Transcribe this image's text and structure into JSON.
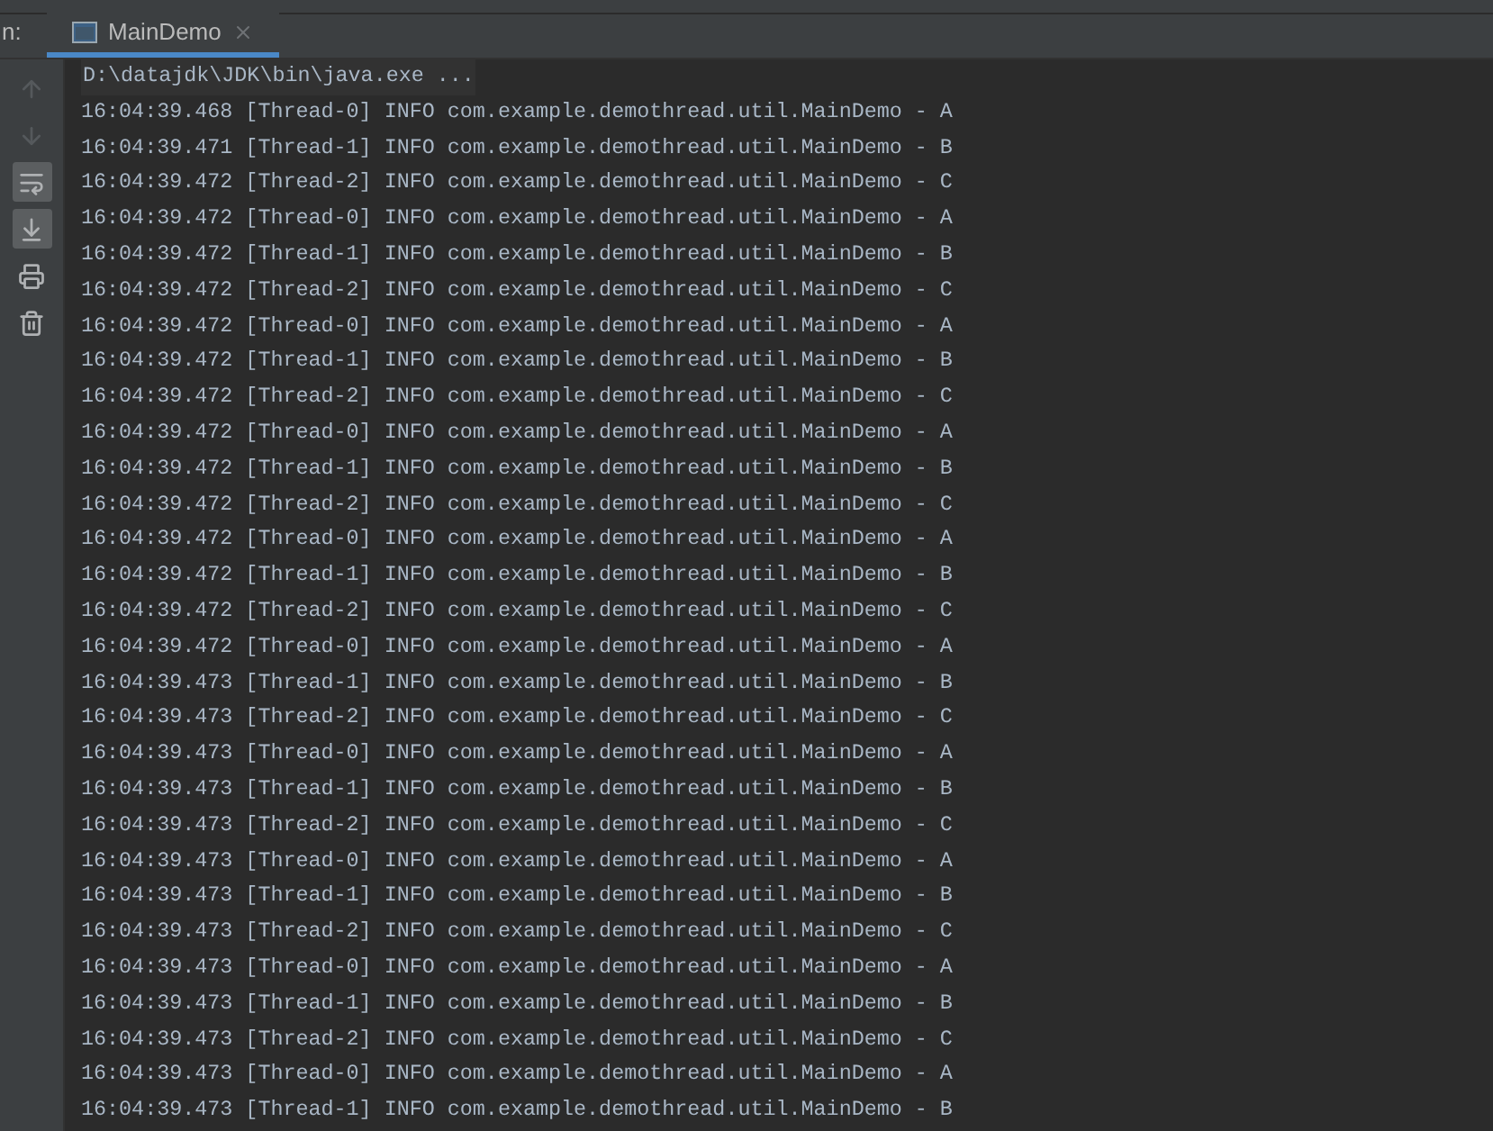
{
  "run_label": "n:",
  "tabs": [
    {
      "label": "MainDemo",
      "selected": true
    }
  ],
  "toolbar": [
    {
      "kind": "up",
      "disabled": true,
      "on": false
    },
    {
      "kind": "down",
      "disabled": true,
      "on": false
    },
    {
      "kind": "wrap",
      "disabled": false,
      "on": true
    },
    {
      "kind": "scroll",
      "disabled": false,
      "on": true
    },
    {
      "kind": "print",
      "disabled": false,
      "on": false
    },
    {
      "kind": "trash",
      "disabled": false,
      "on": false
    }
  ],
  "command": "D:\\datajdk\\JDK\\bin\\java.exe ...",
  "log_lines": [
    "16:04:39.468 [Thread-0] INFO com.example.demothread.util.MainDemo - A",
    "16:04:39.471 [Thread-1] INFO com.example.demothread.util.MainDemo - B",
    "16:04:39.472 [Thread-2] INFO com.example.demothread.util.MainDemo - C",
    "16:04:39.472 [Thread-0] INFO com.example.demothread.util.MainDemo - A",
    "16:04:39.472 [Thread-1] INFO com.example.demothread.util.MainDemo - B",
    "16:04:39.472 [Thread-2] INFO com.example.demothread.util.MainDemo - C",
    "16:04:39.472 [Thread-0] INFO com.example.demothread.util.MainDemo - A",
    "16:04:39.472 [Thread-1] INFO com.example.demothread.util.MainDemo - B",
    "16:04:39.472 [Thread-2] INFO com.example.demothread.util.MainDemo - C",
    "16:04:39.472 [Thread-0] INFO com.example.demothread.util.MainDemo - A",
    "16:04:39.472 [Thread-1] INFO com.example.demothread.util.MainDemo - B",
    "16:04:39.472 [Thread-2] INFO com.example.demothread.util.MainDemo - C",
    "16:04:39.472 [Thread-0] INFO com.example.demothread.util.MainDemo - A",
    "16:04:39.472 [Thread-1] INFO com.example.demothread.util.MainDemo - B",
    "16:04:39.472 [Thread-2] INFO com.example.demothread.util.MainDemo - C",
    "16:04:39.472 [Thread-0] INFO com.example.demothread.util.MainDemo - A",
    "16:04:39.473 [Thread-1] INFO com.example.demothread.util.MainDemo - B",
    "16:04:39.473 [Thread-2] INFO com.example.demothread.util.MainDemo - C",
    "16:04:39.473 [Thread-0] INFO com.example.demothread.util.MainDemo - A",
    "16:04:39.473 [Thread-1] INFO com.example.demothread.util.MainDemo - B",
    "16:04:39.473 [Thread-2] INFO com.example.demothread.util.MainDemo - C",
    "16:04:39.473 [Thread-0] INFO com.example.demothread.util.MainDemo - A",
    "16:04:39.473 [Thread-1] INFO com.example.demothread.util.MainDemo - B",
    "16:04:39.473 [Thread-2] INFO com.example.demothread.util.MainDemo - C",
    "16:04:39.473 [Thread-0] INFO com.example.demothread.util.MainDemo - A",
    "16:04:39.473 [Thread-1] INFO com.example.demothread.util.MainDemo - B",
    "16:04:39.473 [Thread-2] INFO com.example.demothread.util.MainDemo - C",
    "16:04:39.473 [Thread-0] INFO com.example.demothread.util.MainDemo - A",
    "16:04:39.473 [Thread-1] INFO com.example.demothread.util.MainDemo - B"
  ]
}
